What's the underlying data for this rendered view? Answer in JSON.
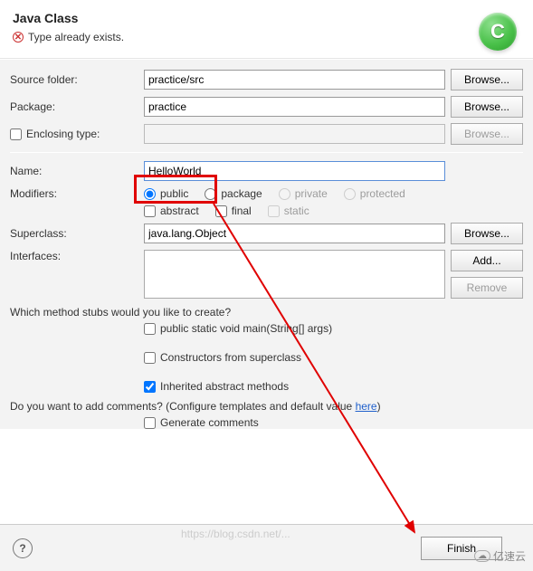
{
  "header": {
    "title": "Java Class",
    "error": "Type already exists.",
    "icon_letter": "C"
  },
  "labels": {
    "source_folder": "Source folder:",
    "package": "Package:",
    "enclosing_type": "Enclosing type:",
    "name": "Name:",
    "modifiers": "Modifiers:",
    "superclass": "Superclass:",
    "interfaces": "Interfaces:"
  },
  "values": {
    "source_folder": "practice/src",
    "package": "practice",
    "enclosing_type": "",
    "name": "HelloWorld",
    "superclass": "java.lang.Object"
  },
  "buttons": {
    "browse": "Browse...",
    "add": "Add...",
    "remove": "Remove",
    "finish": "Finish"
  },
  "modifiers": {
    "public": "public",
    "package": "package",
    "private": "private",
    "protected": "protected",
    "abstract": "abstract",
    "final": "final",
    "static": "static"
  },
  "stubs": {
    "question": "Which method stubs would you like to create?",
    "main": "public static void main(String[] args)",
    "constructors": "Constructors from superclass",
    "inherited": "Inherited abstract methods"
  },
  "comments": {
    "question_prefix": "Do you want to add comments? (Configure templates and default value ",
    "here": "here",
    "question_suffix": ")",
    "generate": "Generate comments"
  },
  "watermark": "https://blog.csdn.net/...",
  "corner": "亿速云"
}
